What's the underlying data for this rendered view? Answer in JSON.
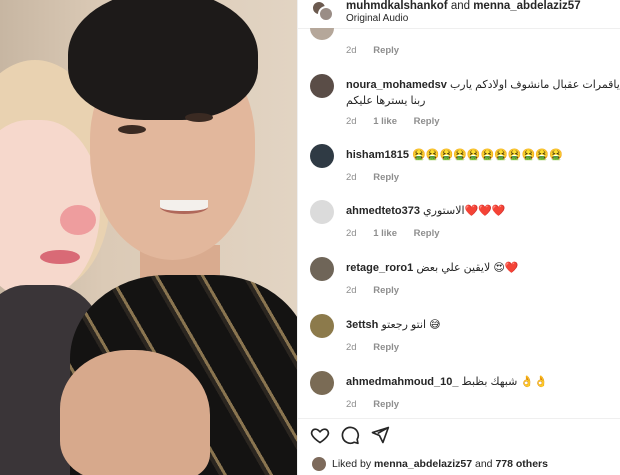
{
  "header": {
    "user1": "muhmdkalshankof",
    "and_word": "and",
    "user2": "menna_abdelaziz57",
    "audio": "Original Audio"
  },
  "comments": [
    {
      "time": "2d",
      "reply": "Reply"
    },
    {
      "user": "noura_mohamedsv",
      "text": "وك ياقمرات عقبال مانشوف اولادكم يارب",
      "text2": "ربنا يسترها عليكم",
      "time": "2d",
      "likes": "1 like",
      "reply": "Reply"
    },
    {
      "user": "hisham1815",
      "text": "🤮🤮🤮🤮🤮🤮🤮🤮🤮🤮🤮",
      "time": "2d",
      "reply": "Reply"
    },
    {
      "user": "ahmedteto373",
      "text": "الاستوري❤️❤️❤️",
      "time": "2d",
      "likes": "1 like",
      "reply": "Reply"
    },
    {
      "user": "retage_roro1",
      "text": "لايقين علي بعض 😍❤️",
      "time": "2d",
      "reply": "Reply"
    },
    {
      "user": "3ettsh",
      "text": "انتو رجعتو 😅",
      "time": "2d",
      "reply": "Reply"
    },
    {
      "user": "ahmedmahmoud_10_",
      "text": "شبهك بظبط 👌👌",
      "time": "2d",
      "reply": "Reply"
    }
  ],
  "actions": {
    "like": "heart-icon",
    "comment": "comment-icon",
    "share": "send-icon"
  },
  "likes": {
    "prefix": "Liked by",
    "user": "menna_abdelaziz57",
    "and_text": "and",
    "count": "778 others"
  }
}
